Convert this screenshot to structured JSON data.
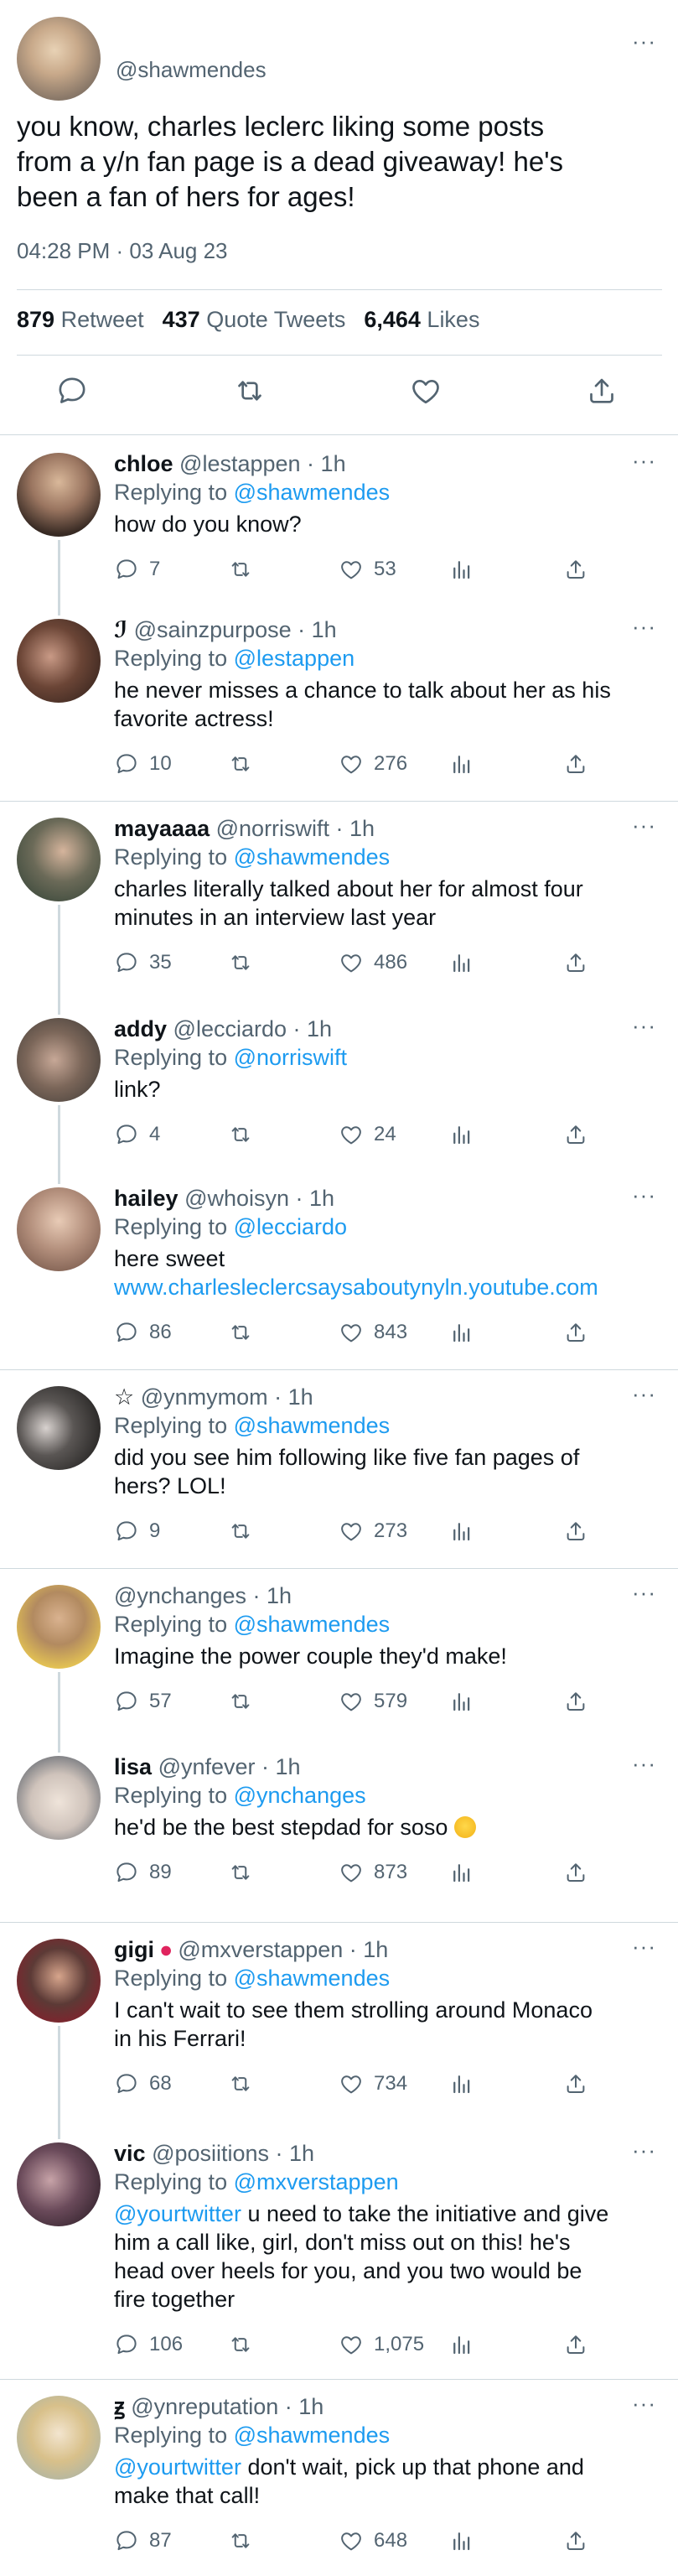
{
  "main_tweet": {
    "handle": "@shawmendes",
    "text_lines": [
      "you know, charles leclerc liking some posts",
      "from a y/n fan page is a dead giveaway! he's",
      "been a fan of hers for ages!"
    ],
    "timestamp": "04:28 PM · 03 Aug 23",
    "retweets": "879",
    "retweets_label": "Retweet",
    "quotes": "437",
    "quotes_label": "Quote Tweets",
    "likes": "6,464",
    "likes_label": "Likes"
  },
  "replies": [
    {
      "name": "chloe",
      "meta": "@lestappen · 1h",
      "replying_label": "Replying to",
      "replying_to": "@shawmendes",
      "body_lines": [
        "how do you know?"
      ],
      "replies": "7",
      "likes": "53"
    },
    {
      "name": "ℐ",
      "meta": "@sainzpurpose · 1h",
      "replying_label": "Replying to",
      "replying_to": "@lestappen",
      "body_lines": [
        "he never misses a chance to talk about her as his",
        "favorite actress!"
      ],
      "replies": "10",
      "likes": "276"
    },
    {
      "name": "mayaaaa",
      "meta": "@norriswift · 1h",
      "replying_label": "Replying to",
      "replying_to": "@shawmendes",
      "body_lines": [
        "charles literally talked about her for almost four",
        "minutes in an interview last year"
      ],
      "replies": "35",
      "likes": "486"
    },
    {
      "name": "addy",
      "meta": "@lecciardo · 1h",
      "replying_label": "Replying to",
      "replying_to": "@norriswift",
      "body_lines": [
        "link?"
      ],
      "replies": "4",
      "likes": "24"
    },
    {
      "name": "hailey",
      "meta": "@whoisyn · 1h",
      "replying_label": "Replying to",
      "replying_to": "@lecciardo",
      "body_lines": [
        "here sweet"
      ],
      "link": "www.charlesleclercsaysaboutynyln.youtube.com",
      "replies": "86",
      "likes": "843"
    },
    {
      "name": "☆",
      "meta": "@ynmymom · 1h",
      "replying_label": "Replying to",
      "replying_to": "@shawmendes",
      "body_lines": [
        "did you see him following like five fan pages of",
        "hers? LOL!"
      ],
      "replies": "9",
      "likes": "273"
    },
    {
      "name": "",
      "meta": "@ynchanges · 1h",
      "replying_label": "Replying to",
      "replying_to": "@shawmendes",
      "body_lines": [
        "Imagine the power couple they'd make!"
      ],
      "replies": "57",
      "likes": "579"
    },
    {
      "name": "lisa",
      "meta": "@ynfever · 1h",
      "replying_label": "Replying to",
      "replying_to": "@ynchanges",
      "body_lines": [
        "he'd be the best stepdad for soso"
      ],
      "replies": "89",
      "likes": "873"
    },
    {
      "name": "gigi",
      "meta": "@mxverstappen · 1h",
      "replying_label": "Replying to",
      "replying_to": "@shawmendes",
      "body_lines": [
        "I can't wait to see them strolling around Monaco",
        "in his Ferrari!"
      ],
      "replies": "68",
      "likes": "734"
    },
    {
      "name": "vic",
      "meta": "@posiitions · 1h",
      "replying_label": "Replying to",
      "replying_to": "@mxverstappen",
      "mention": "@yourtwitter",
      "first_line_rest": " u need to take the initiative and give",
      "body_lines": [
        "him a call like, girl, don't miss out on this! he's",
        "head over heels for you, and you two would be",
        "fire together"
      ],
      "replies": "106",
      "likes": "1,075"
    },
    {
      "name": "ꙃ",
      "meta": "@ynreputation · 1h",
      "replying_label": "Replying to",
      "replying_to": "@shawmendes",
      "mention": "@yourtwitter",
      "first_line_rest": " don't wait, pick up that phone and",
      "body_lines": [
        "make that call!"
      ],
      "replies": "87",
      "likes": "648"
    }
  ],
  "icons": {
    "reply": "reply-icon",
    "retweet": "retweet-icon",
    "like": "heart-icon",
    "views": "views-icon",
    "share": "share-icon",
    "more": "more-icon"
  },
  "colors": {
    "link": "#1d9bf0",
    "secondary_text": "#536471",
    "divider": "#cfd9de"
  }
}
